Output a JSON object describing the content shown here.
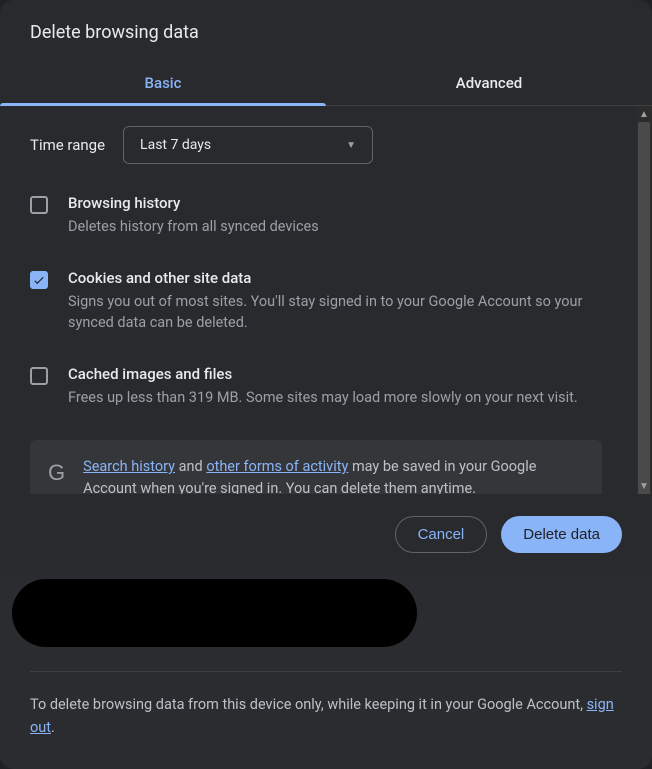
{
  "title": "Delete browsing data",
  "tabs": {
    "basic": "Basic",
    "advanced": "Advanced"
  },
  "time": {
    "label": "Time range",
    "value": "Last 7 days"
  },
  "options": [
    {
      "key": "history",
      "title": "Browsing history",
      "desc": "Deletes history from all synced devices",
      "checked": false
    },
    {
      "key": "cookies",
      "title": "Cookies and other site data",
      "desc": "Signs you out of most sites. You'll stay signed in to your Google Account so your synced data can be deleted.",
      "checked": true
    },
    {
      "key": "cache",
      "title": "Cached images and files",
      "desc": "Frees up less than 319 MB. Some sites may load more slowly on your next visit.",
      "checked": false
    }
  ],
  "info": {
    "link1": "Search history",
    "mid1": " and ",
    "link2": "other forms of activity",
    "rest": " may be saved in your Google Account when you're signed in. You can delete them anytime."
  },
  "buttons": {
    "cancel": "Cancel",
    "action": "Delete data"
  },
  "signout": {
    "pre": "To delete browsing data from this device only, while keeping it in your Google Account, ",
    "link": "sign out",
    "post": "."
  }
}
